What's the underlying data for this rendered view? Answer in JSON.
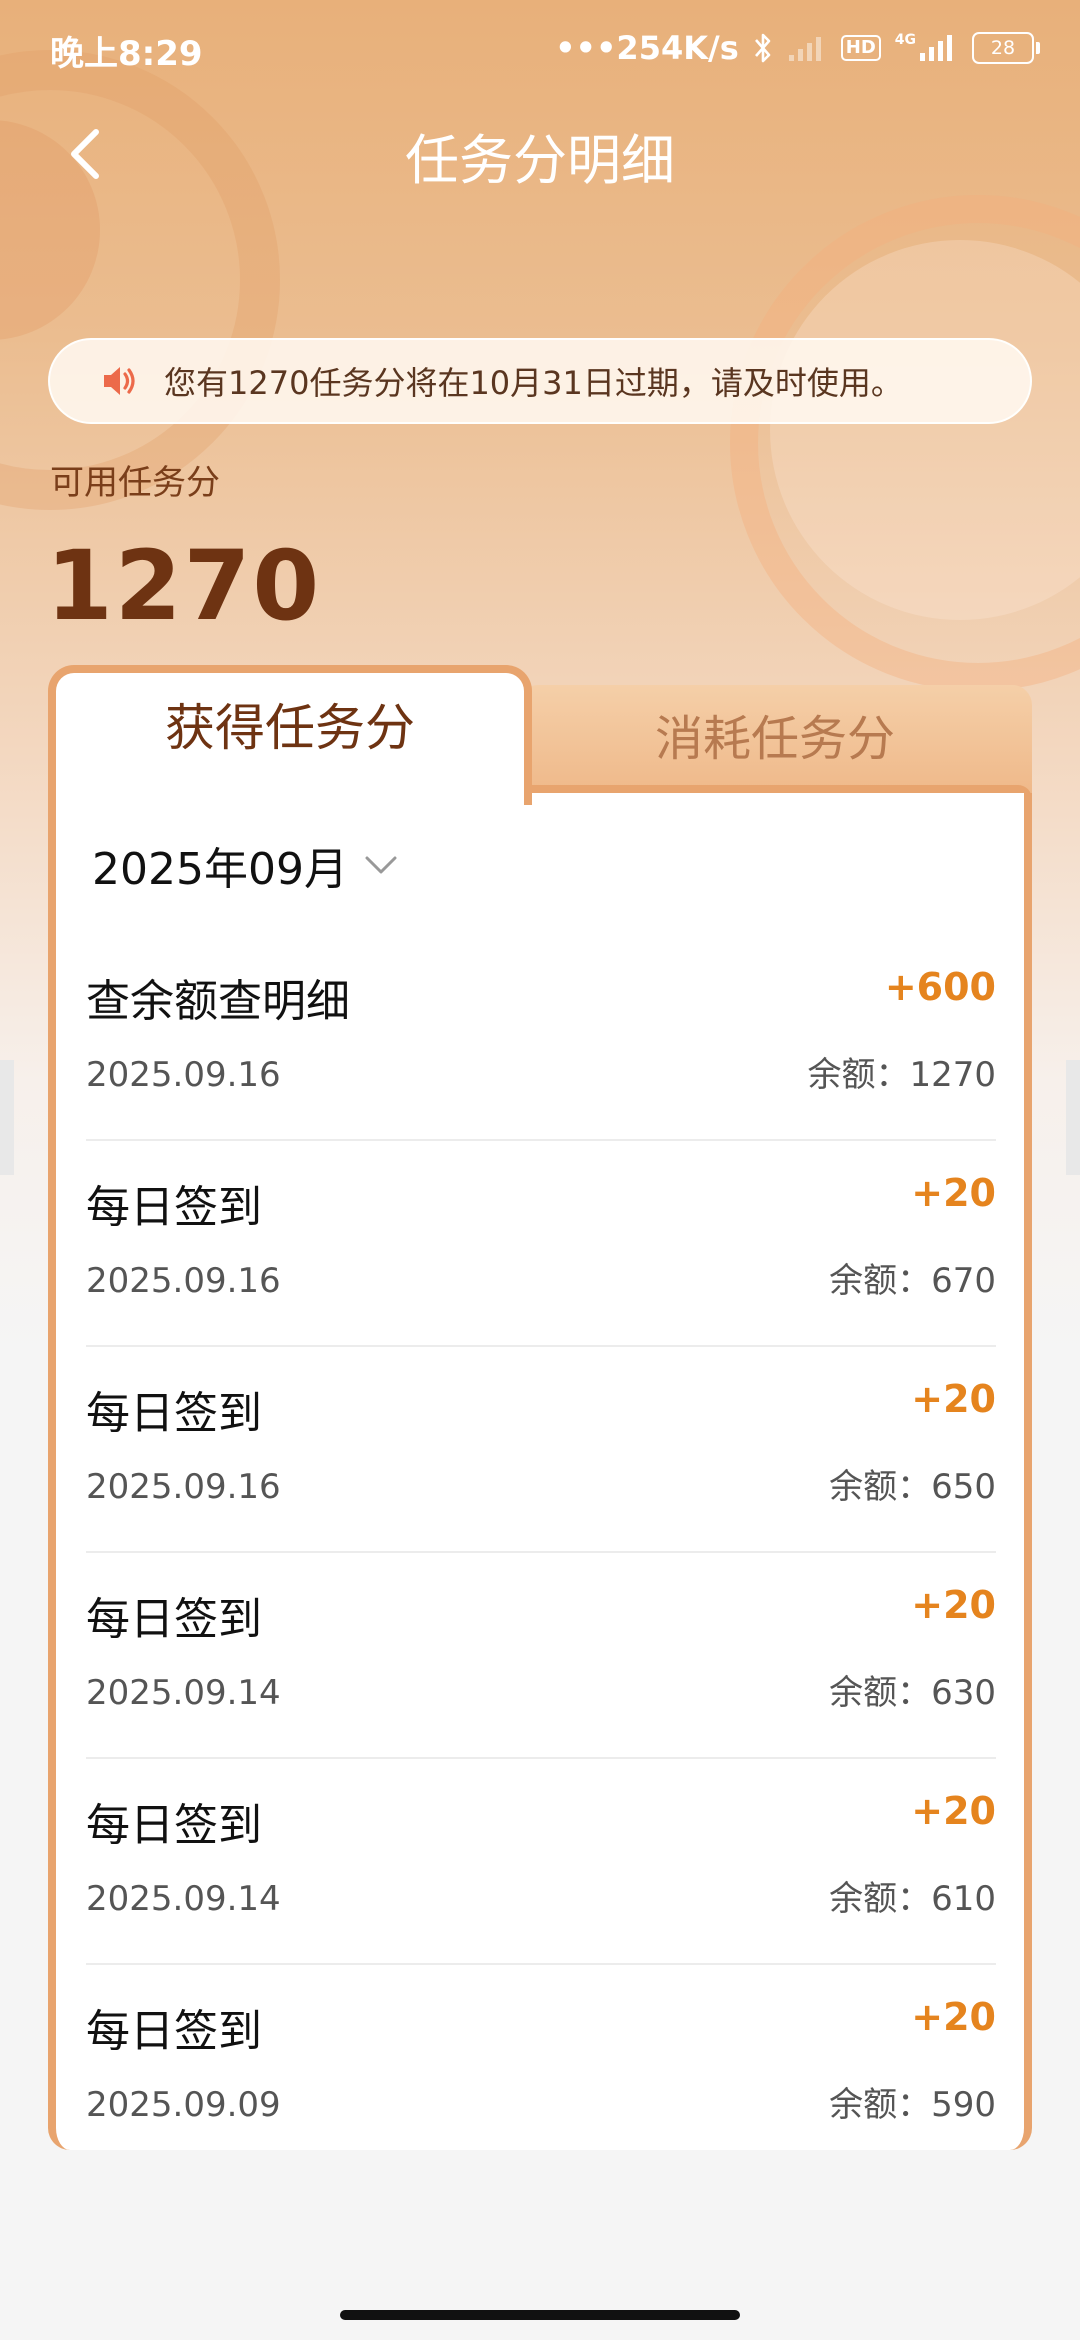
{
  "status_bar": {
    "time": "晚上8:29",
    "network_speed": "254K/s",
    "hd_label": "HD",
    "network_type": "4G",
    "battery": "28"
  },
  "header": {
    "title": "任务分明细",
    "back_icon": "chevron-left-icon"
  },
  "notice": {
    "icon": "speaker-icon",
    "text": "您有1270任务分将在10月31日过期，请及时使用。"
  },
  "points": {
    "label": "可用任务分",
    "value": "1270"
  },
  "tabs": [
    {
      "label": "获得任务分",
      "active": true
    },
    {
      "label": "消耗任务分",
      "active": false
    }
  ],
  "filter": {
    "month": "2025年09月"
  },
  "records": [
    {
      "title": "查余额查明细",
      "amount": "+600",
      "date": "2025.09.16",
      "balance": "余额：1270"
    },
    {
      "title": "每日签到",
      "amount": "+20",
      "date": "2025.09.16",
      "balance": "余额：670"
    },
    {
      "title": "每日签到",
      "amount": "+20",
      "date": "2025.09.16",
      "balance": "余额：650"
    },
    {
      "title": "每日签到",
      "amount": "+20",
      "date": "2025.09.14",
      "balance": "余额：630"
    },
    {
      "title": "每日签到",
      "amount": "+20",
      "date": "2025.09.14",
      "balance": "余额：610"
    },
    {
      "title": "每日签到",
      "amount": "+20",
      "date": "2025.09.09",
      "balance": "余额：590"
    }
  ],
  "colors": {
    "accent": "#e5841e",
    "brown": "#6e3312",
    "tab_border": "#e8a46e"
  }
}
